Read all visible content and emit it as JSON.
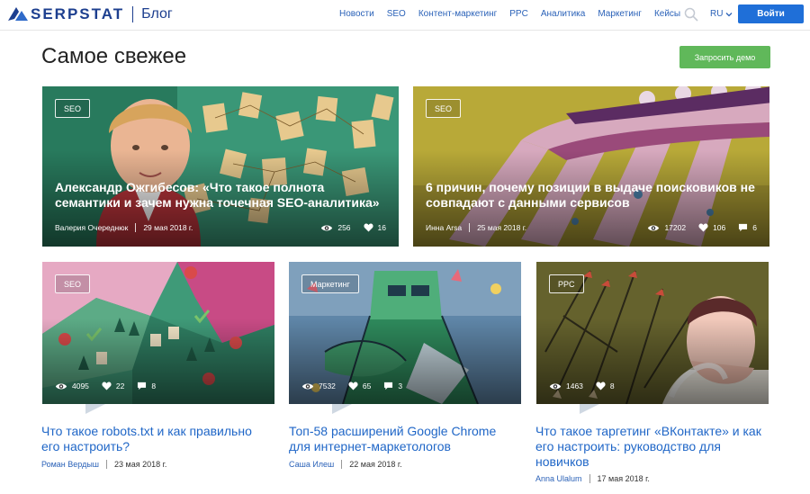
{
  "header": {
    "logo_text": "SERPSTAT",
    "logo_section": "Блог",
    "nav": [
      "Новости",
      "SEO",
      "Контент-маркетинг",
      "PPC",
      "Аналитика",
      "Маркетинг",
      "Кейсы"
    ],
    "lang": "RU",
    "login_label": "Войти"
  },
  "page": {
    "title": "Самое свежее",
    "demo_label": "Запросить демо"
  },
  "featured": [
    {
      "tag": "SEO",
      "title": "Александр Ожгибесов: «Что такое полнота семантики и зачем нужна точечная SEO-аналитика»",
      "author": "Валерия Очереднюк",
      "date": "29 мая 2018 г.",
      "views": "256",
      "likes": "16"
    },
    {
      "tag": "SEO",
      "title": "6 причин, почему позиции в выдаче поисковиков не совпадают с данными сервисов",
      "author": "Инна Arsa",
      "date": "25 мая 2018 г.",
      "views": "17202",
      "likes": "106",
      "comments": "6"
    }
  ],
  "articles": [
    {
      "tag": "SEO",
      "title": "Что такое robots.txt и как правильно его настроить?",
      "author": "Роман Вердыш",
      "date": "23 мая 2018 г.",
      "views": "4095",
      "likes": "22",
      "comments": "8"
    },
    {
      "tag": "Маркетинг",
      "title": "Топ-58 расширений Google Chrome для интернет-маркетологов",
      "author": "Саша Илеш",
      "date": "22 мая 2018 г.",
      "views": "7532",
      "likes": "65",
      "comments": "3"
    },
    {
      "tag": "PPC",
      "title": "Что такое таргетинг «ВКонтакте» и как его настроить: руководство для новичков",
      "author": "Anna Ulalum",
      "date": "17 мая 2018 г.",
      "views": "1463",
      "likes": "8"
    }
  ],
  "colors": {
    "brand": "#1d3f8f",
    "link": "#1f66c7",
    "login": "#1f6fd8",
    "demo": "#60b85a"
  },
  "icons": [
    "serpstat-logo-icon",
    "search-icon",
    "chevron-down-icon",
    "eye-icon",
    "heart-icon",
    "comment-icon"
  ]
}
